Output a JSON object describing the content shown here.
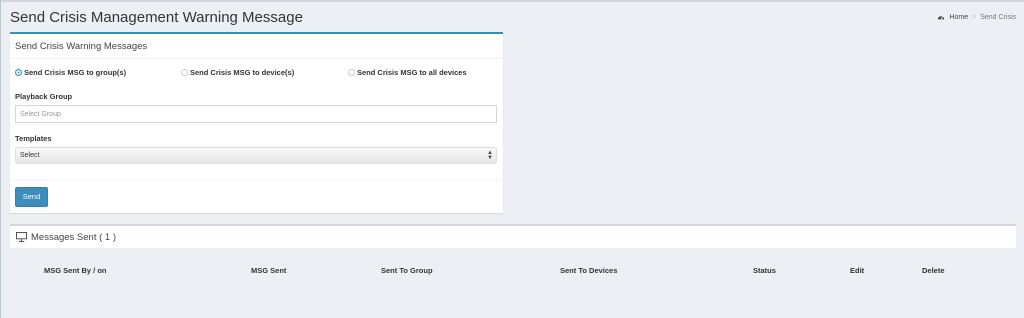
{
  "page": {
    "title": "Send Crisis Management Warning Message"
  },
  "breadcrumb": {
    "home": "Home",
    "separator": ">",
    "current": "Send Crisis",
    "home_icon": "dashboard-icon"
  },
  "form": {
    "header": "Send Crisis Warning Messages",
    "radios": [
      {
        "label": "Send Crisis MSG to group(s)",
        "checked": true
      },
      {
        "label": "Send Crisis MSG to device(s)",
        "checked": false
      },
      {
        "label": "Send Crisis MSG to all devices",
        "checked": false
      }
    ],
    "playback_group": {
      "label": "Playback Group",
      "placeholder": "Select Group",
      "value": ""
    },
    "templates": {
      "label": "Templates",
      "selected": "Select"
    },
    "send_label": "Send"
  },
  "messages": {
    "header": "Messages Sent ( 1 )",
    "icon": "monitor-icon",
    "columns": [
      "MSG Sent By / on",
      "MSG Sent",
      "Sent To Group",
      "Sent To Devices",
      "Status",
      "Edit",
      "Delete"
    ]
  },
  "colors": {
    "accent": "#3c8dbc",
    "background": "#ecf0f5",
    "box_background": "#ffffff"
  }
}
